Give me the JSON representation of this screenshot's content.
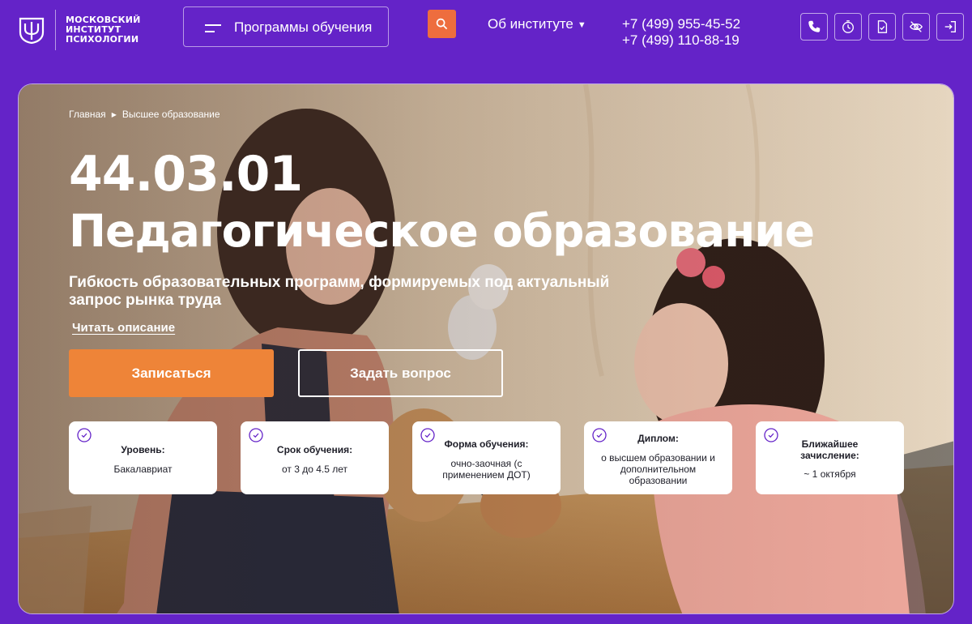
{
  "logo": {
    "lines": [
      "МОСКОВСКИЙ",
      "ИНСТИТУТ",
      "ПСИХОЛОГИИ"
    ]
  },
  "header": {
    "programs_label": "Программы обучения",
    "about_label": "Об институте",
    "phones": [
      "+7 (499) 955-45-52",
      "+7 (499) 110-88-19"
    ],
    "icons": [
      "phone-icon",
      "timer-icon",
      "document-check-icon",
      "eye-off-icon",
      "login-icon"
    ]
  },
  "breadcrumb": {
    "home": "Главная",
    "current": "Высшее образование"
  },
  "hero": {
    "code": "44.03.01",
    "title": "Педагогическое образование",
    "subtitle": "Гибкость образовательных программ, формируемых под актуальный запрос рынка труда",
    "read_more": "Читать описание",
    "enroll_label": "Записаться",
    "ask_label": "Задать вопрос"
  },
  "cards": [
    {
      "title": "Уровень:",
      "value": "Бакалавриат"
    },
    {
      "title": "Срок обучения:",
      "value": "от 3 до 4.5 лет"
    },
    {
      "title": "Форма обучения:",
      "value": "очно-заочная (с применением ДОТ)"
    },
    {
      "title": "Диплом:",
      "value": "о высшем образовании и дополнительном образовании"
    },
    {
      "title": "Ближайшее зачисление:",
      "value": "~ 1 октября"
    }
  ],
  "colors": {
    "brand_purple": "#6423c8",
    "accent_orange": "#ee8438",
    "search_orange": "#ee6d3e"
  }
}
